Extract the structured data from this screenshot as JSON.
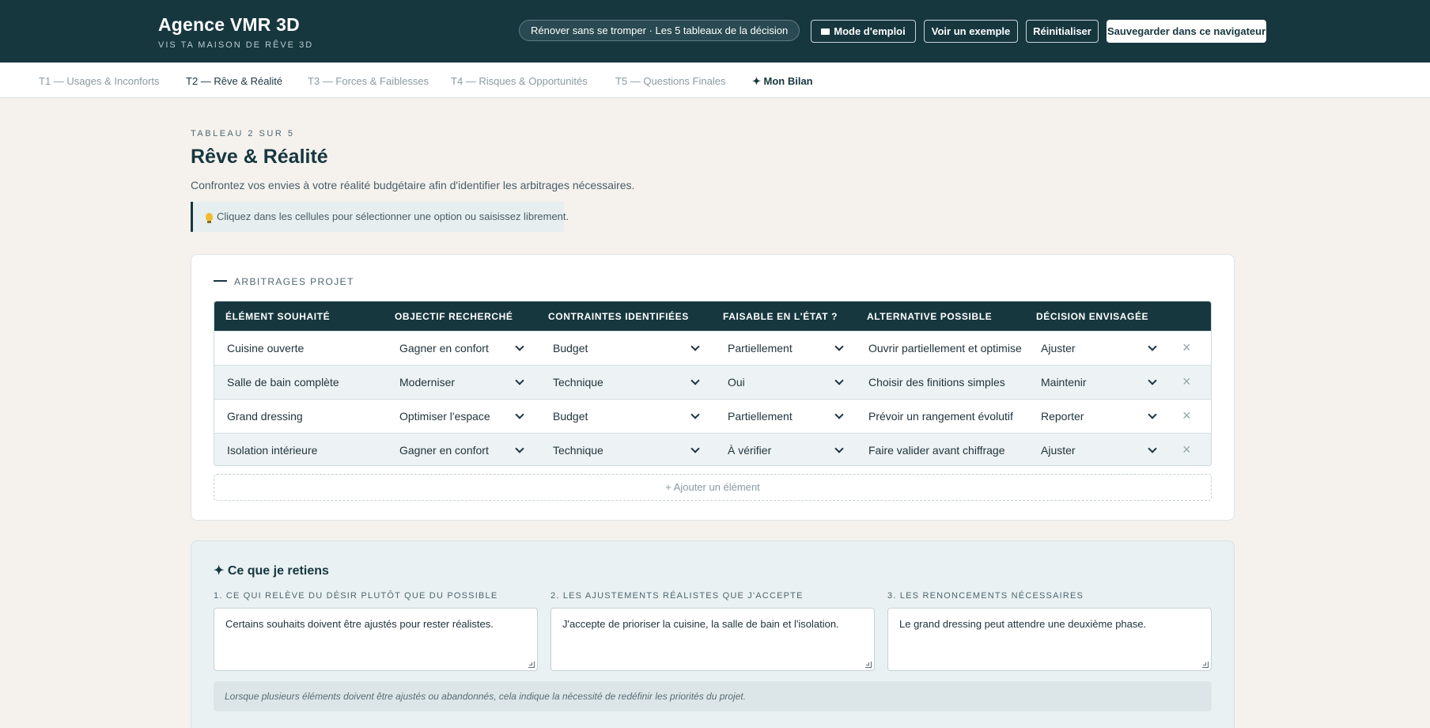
{
  "header": {
    "brand_title": "Agence VMR 3D",
    "brand_subtitle": "VIS TA MAISON DE RÊVE 3D",
    "pill": "Rénover sans se tromper · Les 5 tableaux de la décision",
    "buttons": {
      "guide": "Mode d'emploi",
      "example": "Voir un exemple",
      "reset": "Réinitialiser",
      "save": "Sauvegarder dans ce navigateur"
    }
  },
  "tabs": [
    {
      "label": "T1 — Usages & Inconforts"
    },
    {
      "label": "T2 — Rêve & Réalité"
    },
    {
      "label": "T3 — Forces & Faiblesses"
    },
    {
      "label": "T4 — Risques & Opportunités"
    },
    {
      "label": "T5 — Questions Finales"
    },
    {
      "label": "✦ Mon Bilan"
    }
  ],
  "page": {
    "eyebrow": "TABLEAU 2 SUR 5",
    "title": "Rêve & Réalité",
    "subtitle": "Confrontez vos envies à votre réalité budgétaire afin d'identifier les arbitrages nécessaires.",
    "hint": "Cliquez dans les cellules pour sélectionner une option ou saisissez librement."
  },
  "table": {
    "section_title": "ARBITRAGES PROJET",
    "headers": [
      "ÉLÉMENT SOUHAITÉ",
      "OBJECTIF RECHERCHÉ",
      "CONTRAINTES IDENTIFIÉES",
      "FAISABLE EN L'ÉTAT ?",
      "ALTERNATIVE POSSIBLE",
      "DÉCISION ENVISAGÉE"
    ],
    "rows": [
      {
        "element": "Cuisine ouverte",
        "objectif": "Gagner en confort",
        "contrainte": "Budget",
        "faisable": "Partiellement",
        "alternative": "Ouvrir partiellement et optimise",
        "decision": "Ajuster"
      },
      {
        "element": "Salle de bain complète",
        "objectif": "Moderniser",
        "contrainte": "Technique",
        "faisable": "Oui",
        "alternative": "Choisir des finitions simples",
        "decision": "Maintenir"
      },
      {
        "element": "Grand dressing",
        "objectif": "Optimiser l'espace",
        "contrainte": "Budget",
        "faisable": "Partiellement",
        "alternative": "Prévoir un rangement évolutif",
        "decision": "Reporter"
      },
      {
        "element": "Isolation intérieure",
        "objectif": "Gagner en confort",
        "contrainte": "Technique",
        "faisable": "À vérifier",
        "alternative": "Faire valider avant chiffrage",
        "decision": "Ajuster"
      }
    ],
    "delete_glyph": "×",
    "add_label": "+ Ajouter un élément"
  },
  "retiens": {
    "title": "✦ Ce que je retiens",
    "columns": [
      {
        "label": "1. CE QUI RELÈVE DU DÉSIR PLUTÔT QUE DU POSSIBLE",
        "value": "Certains souhaits doivent être ajustés pour rester réalistes."
      },
      {
        "label": "2. LES AJUSTEMENTS RÉALISTES QUE J'ACCEPTE",
        "value": "J'accepte de prioriser la cuisine, la salle de bain et l'isolation."
      },
      {
        "label": "3. LES RENONCEMENTS NÉCESSAIRES",
        "value": "Le grand dressing peut attendre une deuxième phase."
      }
    ],
    "note": "Lorsque plusieurs éléments doivent être ajustés ou abandonnés, cela indique la nécessité de redéfinir les priorités du projet."
  },
  "icons": {
    "guide": "book-icon",
    "hint": "lightbulb-icon",
    "select": "chevron-down-icon",
    "delete": "close-icon"
  },
  "colors": {
    "primary": "#17373f",
    "background": "#f5f2ee",
    "row_alt": "#edf3f4"
  }
}
